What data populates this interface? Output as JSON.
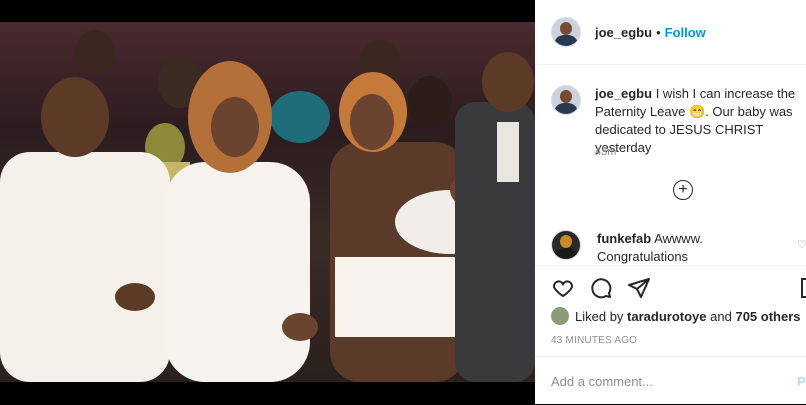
{
  "header": {
    "username": "joe_egbu",
    "separator": "•",
    "follow_label": "Follow"
  },
  "caption": {
    "username": "joe_egbu",
    "text": "I wish I can increase the Paternity Leave 😁. Our baby was dedicated to JESUS CHRIST yesterday",
    "time": "43m"
  },
  "load_more_icon": "plus-circle-icon",
  "comments": [
    {
      "username": "funkefab",
      "text": "Awwww. Congratulations"
    }
  ],
  "actions": {
    "like_icon": "heart-icon",
    "comment_icon": "comment-icon",
    "share_icon": "share-icon",
    "save_icon": "bookmark-icon"
  },
  "likes": {
    "prefix": "Liked by",
    "user": "taradurotoye",
    "connector": "and",
    "others": "705 others"
  },
  "timestamp": "43 MINUTES AGO",
  "add_comment": {
    "placeholder": "Add a comment...",
    "post_label": "Post"
  },
  "colors": {
    "link": "#0095f6",
    "muted": "#8e8e8e",
    "text": "#262626"
  }
}
